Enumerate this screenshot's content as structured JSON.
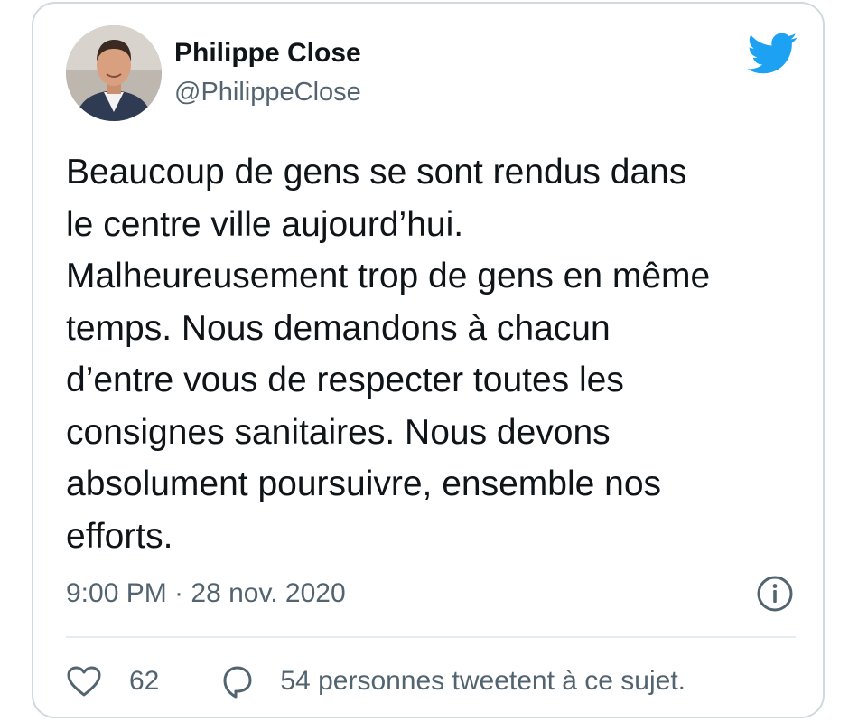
{
  "author": {
    "name": "Philippe Close",
    "handle": "@PhilippeClose"
  },
  "tweet": {
    "text": "Beaucoup de gens se sont rendus dans\nle centre ville aujourd’hui.\nMalheureusement trop de gens en même\ntemps. Nous demandons à chacun\nd’entre vous de respecter toutes les\nconsignes sanitaires. Nous devons\nabsolument poursuivre, ensemble nos\nefforts.",
    "timestamp": "9:00 PM · 28 nov. 2020"
  },
  "engagement": {
    "likes": "62",
    "replies_text": "54 personnes tweetent à ce sujet."
  },
  "colors": {
    "twitter_blue": "#1da1f2",
    "secondary_text": "#536471",
    "border": "#cfd9de"
  },
  "icons": [
    "twitter-bird-icon",
    "info-icon",
    "heart-icon",
    "reply-icon"
  ]
}
